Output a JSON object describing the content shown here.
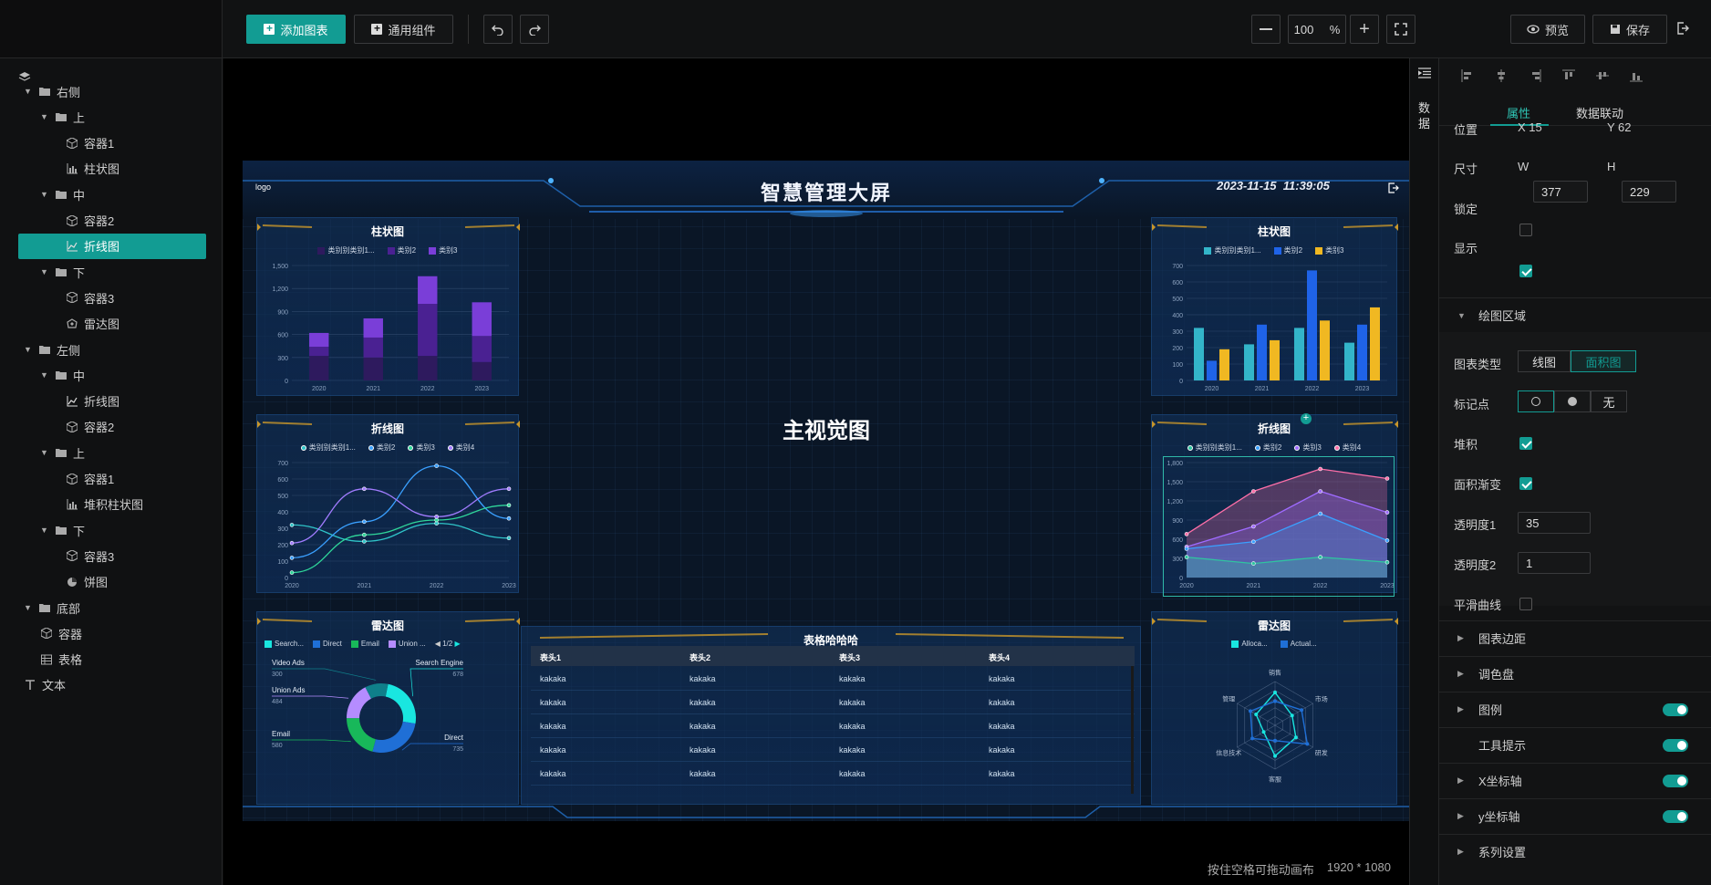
{
  "toolbar": {
    "add_chart": "添加图表",
    "common_widgets": "通用组件",
    "zoom": "100",
    "zoom_unit": "%",
    "preview": "预览",
    "save": "保存"
  },
  "tree": [
    {
      "label": "右侧",
      "type": "folder",
      "depth": 0
    },
    {
      "label": "上",
      "type": "folder",
      "depth": 1
    },
    {
      "label": "容器1",
      "type": "container",
      "depth": 2
    },
    {
      "label": "柱状图",
      "type": "bar",
      "depth": 2
    },
    {
      "label": "中",
      "type": "folder",
      "depth": 1
    },
    {
      "label": "容器2",
      "type": "container",
      "depth": 2
    },
    {
      "label": "折线图",
      "type": "line",
      "depth": 2,
      "active": true
    },
    {
      "label": "下",
      "type": "folder",
      "depth": 1
    },
    {
      "label": "容器3",
      "type": "container",
      "depth": 2
    },
    {
      "label": "雷达图",
      "type": "radar",
      "depth": 2
    },
    {
      "label": "左侧",
      "type": "folder",
      "depth": 0
    },
    {
      "label": "中",
      "type": "folder",
      "depth": 1
    },
    {
      "label": "折线图",
      "type": "line",
      "depth": 2
    },
    {
      "label": "容器2",
      "type": "container",
      "depth": 2
    },
    {
      "label": "上",
      "type": "folder",
      "depth": 1
    },
    {
      "label": "容器1",
      "type": "container",
      "depth": 2
    },
    {
      "label": "堆积柱状图",
      "type": "bar",
      "depth": 2
    },
    {
      "label": "下",
      "type": "folder",
      "depth": 1
    },
    {
      "label": "容器3",
      "type": "container",
      "depth": 2
    },
    {
      "label": "饼图",
      "type": "pie",
      "depth": 2
    },
    {
      "label": "底部",
      "type": "folder",
      "depth": 0
    },
    {
      "label": "容器",
      "type": "container",
      "depth": 1
    },
    {
      "label": "表格",
      "type": "table",
      "depth": 1
    },
    {
      "label": "文本",
      "type": "text",
      "depth": 0
    }
  ],
  "screen": {
    "logo": "logo",
    "title": "智慧管理大屏",
    "datetime": "2023-11-15  11:39:05",
    "main_visual": "主视觉图",
    "table_title": "表格哈哈哈",
    "table_headers": [
      "表头1",
      "表头2",
      "表头3",
      "表头4"
    ],
    "table_rows": [
      [
        "kakaka",
        "kakaka",
        "kakaka",
        "kakaka"
      ],
      [
        "kakaka",
        "kakaka",
        "kakaka",
        "kakaka"
      ],
      [
        "kakaka",
        "kakaka",
        "kakaka",
        "kakaka"
      ],
      [
        "kakaka",
        "kakaka",
        "kakaka",
        "kakaka"
      ],
      [
        "kakaka",
        "kakaka",
        "kakaka",
        "kakaka"
      ]
    ]
  },
  "chart_data": [
    {
      "type": "bar",
      "title": "柱状图",
      "stacked": true,
      "categories": [
        "2020",
        "2021",
        "2022",
        "2023"
      ],
      "ylim": [
        0,
        1500
      ],
      "yticks": [
        "0",
        "300",
        "600",
        "900",
        "1,200",
        "1,500"
      ],
      "series": [
        {
          "name": "类别别类别1...",
          "color": "#2e1a5e",
          "values": [
            320,
            300,
            320,
            240
          ]
        },
        {
          "name": "类别2",
          "color": "#4a2192",
          "values": [
            120,
            260,
            680,
            340
          ]
        },
        {
          "name": "类别3",
          "color": "#7a3ed8",
          "values": [
            180,
            250,
            360,
            440
          ]
        }
      ]
    },
    {
      "type": "line",
      "title": "折线图",
      "smooth": true,
      "categories": [
        "2020",
        "2021",
        "2022",
        "2023"
      ],
      "ylim": [
        0,
        700
      ],
      "yticks": [
        "0",
        "100",
        "200",
        "300",
        "400",
        "500",
        "600",
        "700"
      ],
      "series": [
        {
          "name": "类别别类别1...",
          "color": "#2fc4c8",
          "values": [
            320,
            220,
            330,
            240
          ]
        },
        {
          "name": "类别2",
          "color": "#3aa0ff",
          "values": [
            120,
            340,
            680,
            360
          ]
        },
        {
          "name": "类别3",
          "color": "#2fd69a",
          "values": [
            30,
            260,
            350,
            440
          ]
        },
        {
          "name": "类别4",
          "color": "#a17cff",
          "values": [
            210,
            540,
            370,
            540
          ]
        }
      ]
    },
    {
      "type": "pie",
      "title": "雷达图",
      "legend": [
        "Search...",
        "Direct",
        "Email",
        "Union ..."
      ],
      "legend_page": "1/2",
      "slices": [
        {
          "name": "Search Engine",
          "value": 678,
          "color": "#19e6e0"
        },
        {
          "name": "Direct",
          "value": 735,
          "color": "#1f6fd6"
        },
        {
          "name": "Email",
          "value": 580,
          "color": "#18b85a"
        },
        {
          "name": "Union Ads",
          "value": 484,
          "color": "#b58cff"
        },
        {
          "name": "Video Ads",
          "value": 300,
          "color": "#0f7f8a"
        }
      ]
    },
    {
      "type": "bar",
      "title": "柱状图",
      "categories": [
        "2020",
        "2021",
        "2022",
        "2023"
      ],
      "ylim": [
        0,
        700
      ],
      "yticks": [
        "0",
        "100",
        "200",
        "300",
        "400",
        "500",
        "600",
        "700"
      ],
      "series": [
        {
          "name": "类别别类别1...",
          "color": "#33b5c9",
          "values": [
            320,
            220,
            320,
            230
          ]
        },
        {
          "name": "类别2",
          "color": "#1f63e8",
          "values": [
            120,
            340,
            670,
            340
          ]
        },
        {
          "name": "类别3",
          "color": "#f0b822",
          "values": [
            190,
            245,
            365,
            445
          ]
        }
      ]
    },
    {
      "type": "area",
      "title": "折线图",
      "stacked": true,
      "categories": [
        "2020",
        "2021",
        "2022",
        "2023"
      ],
      "ylim": [
        0,
        1800
      ],
      "yticks": [
        "0",
        "300",
        "600",
        "900",
        "1,200",
        "1,500",
        "1,800"
      ],
      "series": [
        {
          "name": "类别别类别1...",
          "color": "#2fc4a0",
          "values": [
            320,
            220,
            320,
            240
          ]
        },
        {
          "name": "类别2",
          "color": "#3aa0ff",
          "values": [
            450,
            560,
            1000,
            580
          ]
        },
        {
          "name": "类别3",
          "color": "#9f6bff",
          "values": [
            480,
            800,
            1350,
            1020
          ]
        },
        {
          "name": "类别4",
          "color": "#ff6fa8",
          "values": [
            680,
            1350,
            1700,
            1550
          ]
        }
      ]
    },
    {
      "type": "radar",
      "title": "雷达图",
      "indicators": [
        "销售",
        "市场",
        "研发",
        "客服",
        "信息技术",
        "管理"
      ],
      "series": [
        {
          "name": "Alloca...",
          "color": "#19e6e0",
          "values": [
            0.75,
            0.45,
            0.55,
            0.7,
            0.3,
            0.5
          ]
        },
        {
          "name": "Actual...",
          "color": "#1f6fd6",
          "values": [
            0.55,
            0.7,
            0.85,
            0.35,
            0.6,
            0.65
          ]
        }
      ]
    }
  ],
  "props": {
    "tabs": [
      "属性",
      "数据联动"
    ],
    "position_label": "位置",
    "x_label": "X 15",
    "y_label": "Y 62",
    "size_label": "尺寸",
    "w_label": "W",
    "w_value": "377",
    "h_label": "H",
    "h_value": "229",
    "lock_label": "锁定",
    "show_label": "显示",
    "section_plot": "绘图区域",
    "chart_type_label": "图表类型",
    "chart_type_options": [
      "线图",
      "面积图"
    ],
    "marker_label": "标记点",
    "marker_none": "无",
    "stack_label": "堆积",
    "gradient_label": "面积渐变",
    "opacity1_label": "透明度1",
    "opacity1_value": "35",
    "opacity2_label": "透明度2",
    "opacity2_value": "1",
    "smooth_label": "平滑曲线",
    "sections": [
      "图表边距",
      "调色盘",
      "图例",
      "工具提示",
      "X坐标轴",
      "y坐标轴",
      "系列设置"
    ]
  },
  "datastrip": {
    "label": "数据"
  },
  "status": {
    "hint": "按住空格可拖动画布",
    "resolution": "1920 * 1080"
  },
  "colors": {
    "accent": "#129c93"
  }
}
